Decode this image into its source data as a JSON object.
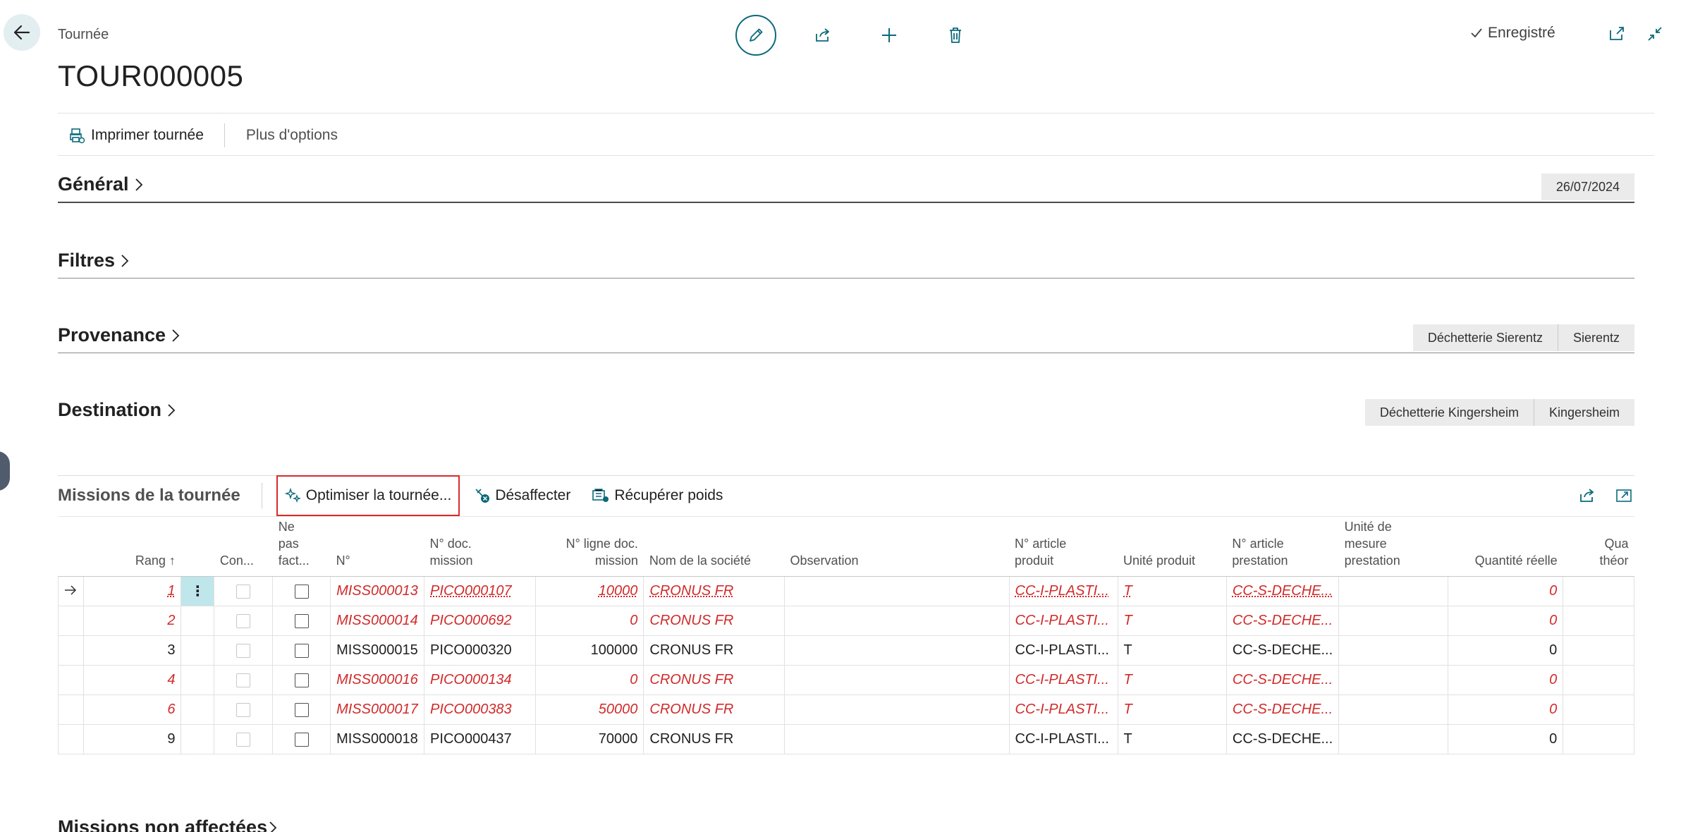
{
  "header": {
    "caption": "Tournée",
    "title": "TOUR000005",
    "saved_label": "Enregistré"
  },
  "actionbar": {
    "print_label": "Imprimer tournée",
    "more_label": "Plus d'options"
  },
  "sections": {
    "general": {
      "title": "Général",
      "tags": [
        "26/07/2024"
      ]
    },
    "filters": {
      "title": "Filtres",
      "tags": []
    },
    "origin": {
      "title": "Provenance",
      "tags": [
        "Déchetterie Sierentz",
        "Sierentz"
      ]
    },
    "destination": {
      "title": "Destination",
      "tags": [
        "Déchetterie Kingersheim",
        "Kingersheim"
      ]
    },
    "unassigned": {
      "title": "Missions non affectées"
    }
  },
  "missions": {
    "title": "Missions de la tournée",
    "buttons": {
      "optimize": "Optimiser la tournée...",
      "unassign": "Désaffecter",
      "weights": "Récupérer poids"
    },
    "columns": {
      "rank": "Rang ↑",
      "con": "Con...",
      "nofact": [
        "Ne",
        "pas",
        "fact..."
      ],
      "no": "N°",
      "doc": [
        "N° doc.",
        "mission"
      ],
      "line": [
        "N° ligne doc.",
        "mission"
      ],
      "company": "Nom de la société",
      "observation": "Observation",
      "article": [
        "N° article",
        "produit"
      ],
      "unit": "Unité produit",
      "service": [
        "N° article",
        "prestation"
      ],
      "service_unit": [
        "Unité de",
        "mesure",
        "prestation"
      ],
      "qty": "Quantité réelle",
      "qty_theo": [
        "Qua",
        "théor"
      ]
    },
    "rows": [
      {
        "rank": "1",
        "no": "MISS000013",
        "doc": "PICO000107",
        "line": "10000",
        "company": "CRONUS FR",
        "article": "CC-I-PLASTI...",
        "unit": "T",
        "service": "CC-S-DECHE...",
        "qty": "0",
        "red": true,
        "current": true
      },
      {
        "rank": "2",
        "no": "MISS000014",
        "doc": "PICO000692",
        "line": "0",
        "company": "CRONUS FR",
        "article": "CC-I-PLASTI...",
        "unit": "T",
        "service": "CC-S-DECHE...",
        "qty": "0",
        "red": true
      },
      {
        "rank": "3",
        "no": "MISS000015",
        "doc": "PICO000320",
        "line": "100000",
        "company": "CRONUS FR",
        "article": "CC-I-PLASTI...",
        "unit": "T",
        "service": "CC-S-DECHE...",
        "qty": "0",
        "red": false
      },
      {
        "rank": "4",
        "no": "MISS000016",
        "doc": "PICO000134",
        "line": "0",
        "company": "CRONUS FR",
        "article": "CC-I-PLASTI...",
        "unit": "T",
        "service": "CC-S-DECHE...",
        "qty": "0",
        "red": true
      },
      {
        "rank": "6",
        "no": "MISS000017",
        "doc": "PICO000383",
        "line": "50000",
        "company": "CRONUS FR",
        "article": "CC-I-PLASTI...",
        "unit": "T",
        "service": "CC-S-DECHE...",
        "qty": "0",
        "red": true
      },
      {
        "rank": "9",
        "no": "MISS000018",
        "doc": "PICO000437",
        "line": "70000",
        "company": "CRONUS FR",
        "article": "CC-I-PLASTI...",
        "unit": "T",
        "service": "CC-S-DECHE...",
        "qty": "0",
        "red": false
      }
    ]
  },
  "colors": {
    "accent": "#0b6a7a",
    "error_red": "#d12a2a",
    "highlight_box": "#d92b2b",
    "selected_cell": "#bfe7eb"
  },
  "icons": [
    "back-arrow-icon",
    "edit-pencil-icon",
    "share-icon",
    "add-icon",
    "delete-icon",
    "checkmark-icon",
    "open-new-window-icon",
    "collapse-icon",
    "print-icon",
    "chevron-right-icon",
    "optimize-icon",
    "unassign-icon",
    "weights-icon",
    "row-arrow-icon",
    "row-menu-icon"
  ]
}
